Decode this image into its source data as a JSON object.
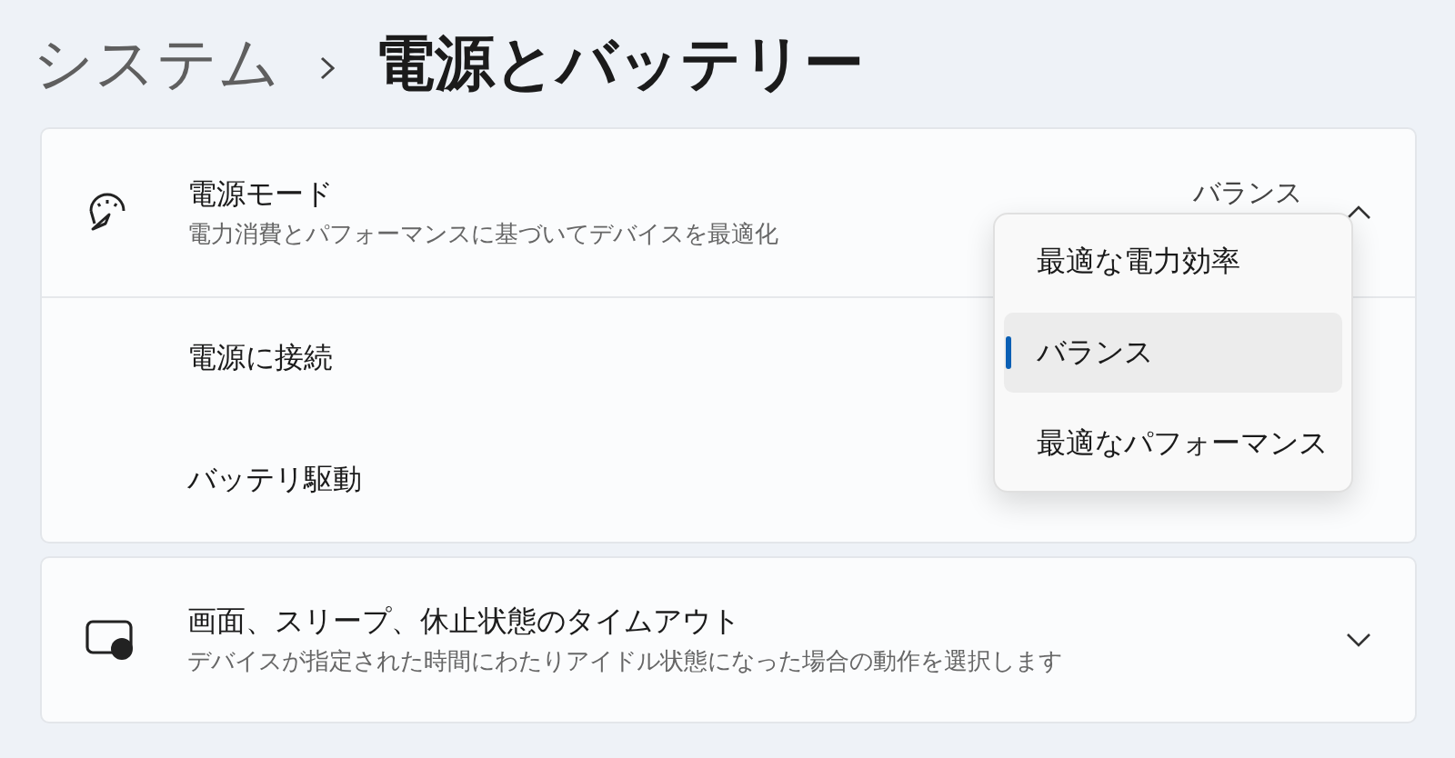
{
  "breadcrumb": {
    "parent": "システム",
    "current": "電源とバッテリー"
  },
  "power_mode": {
    "title": "電源モード",
    "description": "電力消費とパフォーマンスに基づいてデバイスを最適化",
    "value": "バランス",
    "expanded": true,
    "rows": [
      {
        "label": "電源に接続"
      },
      {
        "label": "バッテリ駆動"
      }
    ],
    "options": [
      {
        "label": "最適な電力効率",
        "selected": false
      },
      {
        "label": "バランス",
        "selected": true
      },
      {
        "label": "最適なパフォーマンス",
        "selected": false
      }
    ]
  },
  "timeout": {
    "title": "画面、スリープ、休止状態のタイムアウト",
    "description": "デバイスが指定された時間にわたりアイドル状態になった場合の動作を選択します",
    "expanded": false
  }
}
